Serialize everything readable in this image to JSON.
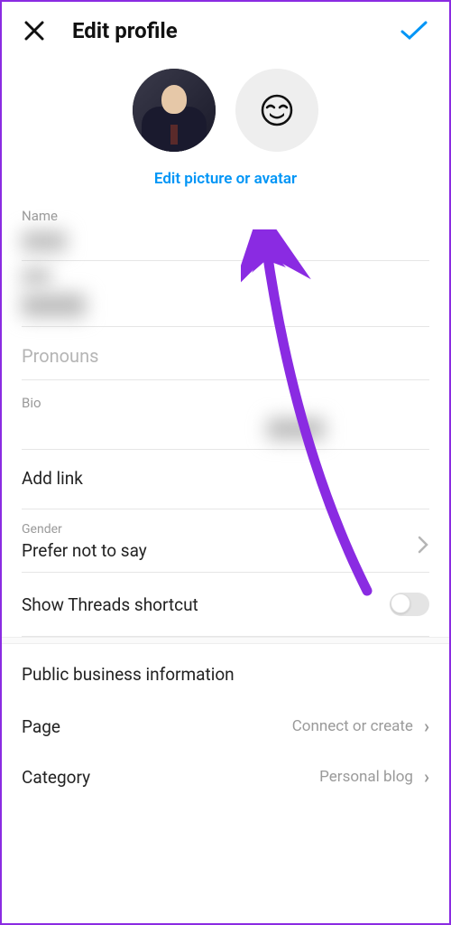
{
  "header": {
    "title": "Edit profile"
  },
  "edit_picture_label": "Edit picture or avatar",
  "fields": {
    "name_label": "Name",
    "pronouns_placeholder": "Pronouns",
    "bio_label": "Bio",
    "add_link_label": "Add link",
    "gender_label": "Gender",
    "gender_value": "Prefer not to say",
    "threads_label": "Show Threads shortcut"
  },
  "business": {
    "header": "Public business information",
    "page_label": "Page",
    "page_value": "Connect or create",
    "category_label": "Category",
    "category_value": "Personal blog"
  },
  "toggles": {
    "threads_on": false
  },
  "colors": {
    "accent": "#0095f6",
    "annotation": "#8a2be2"
  }
}
